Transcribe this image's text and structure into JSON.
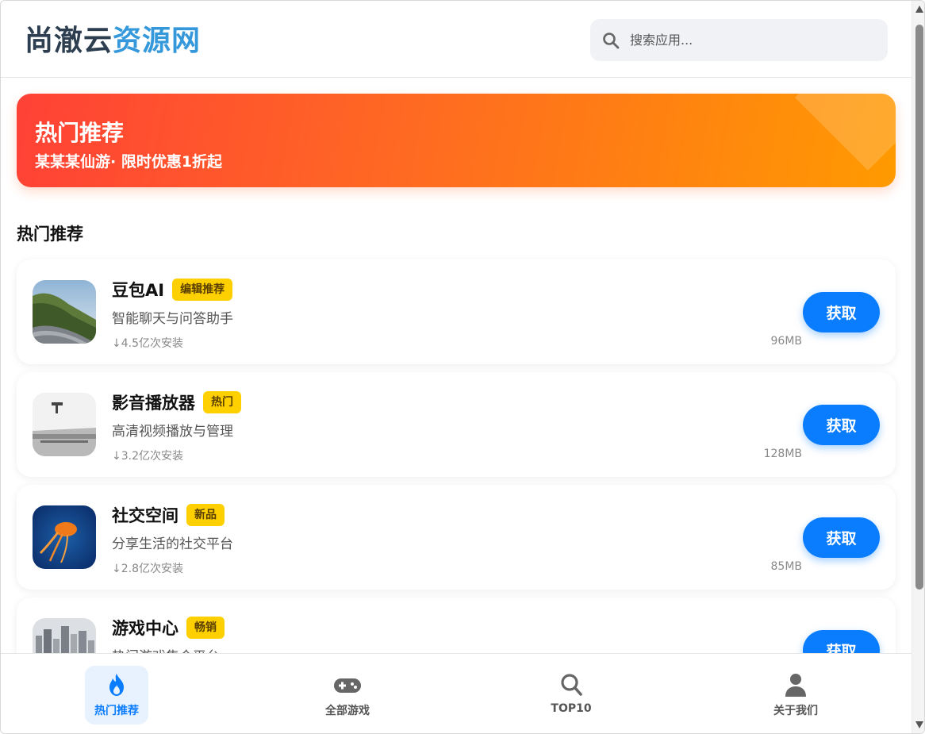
{
  "header": {
    "logo_part1": "尚澈云",
    "logo_part2": "资源网",
    "search_placeholder": "搜索应用..."
  },
  "banner": {
    "title": "热门推荐",
    "subtitle": "某某某仙游· 限时优惠1折起"
  },
  "section_title": "热门推荐",
  "apps": [
    {
      "name": "豆包AI",
      "badge": "编辑推荐",
      "desc": "智能聊天与问答助手",
      "installs": "↓4.5亿次安装",
      "size": "96MB",
      "action": "获取"
    },
    {
      "name": "影音播放器",
      "badge": "热门",
      "desc": "高清视频播放与管理",
      "installs": "↓3.2亿次安装",
      "size": "128MB",
      "action": "获取"
    },
    {
      "name": "社交空间",
      "badge": "新品",
      "desc": "分享生活的社交平台",
      "installs": "↓2.8亿次安装",
      "size": "85MB",
      "action": "获取"
    },
    {
      "name": "游戏中心",
      "badge": "畅销",
      "desc": "热门游戏集合平台",
      "installs": "",
      "size": "",
      "action": "获取"
    }
  ],
  "nav": [
    {
      "label": "热门推荐",
      "icon": "fire-icon",
      "active": true
    },
    {
      "label": "全部游戏",
      "icon": "gamepad-icon",
      "active": false
    },
    {
      "label": "TOP10",
      "icon": "search-icon",
      "active": false
    },
    {
      "label": "关于我们",
      "icon": "user-icon",
      "active": false
    }
  ],
  "colors": {
    "accent": "#0a7dff",
    "badge": "#ffd000",
    "banner_start": "#ff4136",
    "banner_end": "#ff9a00",
    "logo_dark": "#2c3e50",
    "logo_blue": "#3498db"
  }
}
